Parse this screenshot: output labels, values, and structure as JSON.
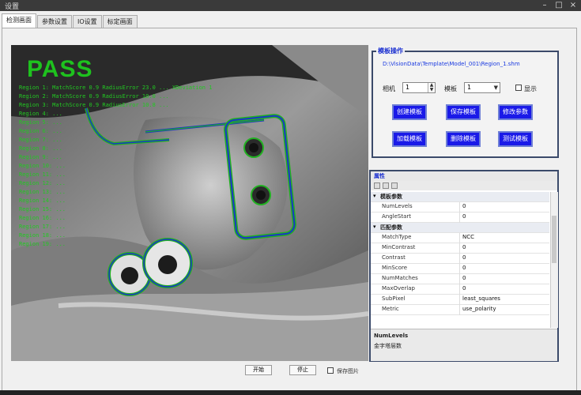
{
  "window": {
    "title": "设置"
  },
  "tabs": [
    {
      "label": "检测画面",
      "active": true
    },
    {
      "label": "参数设置",
      "active": false
    },
    {
      "label": "IO设置",
      "active": false
    },
    {
      "label": "标定画面",
      "active": false
    }
  ],
  "viewer": {
    "result": "PASS",
    "result_color": "#1ec21e",
    "readouts": [
      "Region 1:  MatchScore 0.9   RadiusError 23.0   ...   XDeviation  1",
      "Region 2:  MatchScore 0.9   RadiusError 10.0   ...",
      "Region 3:  MatchScore 0.9   RadiusError 10.8   ...",
      "Region 4:  ...",
      "Region 5:  ...",
      "Region 6:  ...",
      "Region 7:  ...",
      "Region 8:  ...",
      "Region 9:  ...",
      "Region 10: ...",
      "Region 11: ...",
      "Region 12: ...",
      "Region 13: ...",
      "Region 14: ...",
      "Region 15: ...",
      "Region 16: ...",
      "Region 17: ...",
      "Region 18: ...",
      "Region 19: ..."
    ]
  },
  "operations": {
    "title": "模板操作",
    "path": "D:\\VisionData\\Template\\Model_001\\Region_1.shm",
    "camera_label": "相机",
    "camera_value": "1",
    "template_label": "模板",
    "template_value": "1",
    "checkbox_label": "显示",
    "buttons": [
      "创建模板",
      "保存模板",
      "修改参数",
      "加载模板",
      "删除模板",
      "测试模板"
    ]
  },
  "properties": {
    "title": "属性",
    "rows": [
      {
        "category": true,
        "key": "模板参数"
      },
      {
        "key": "NumLevels",
        "value": "0"
      },
      {
        "key": "AngleStart",
        "value": "0"
      },
      {
        "category": true,
        "key": "匹配参数"
      },
      {
        "key": "MatchType",
        "value": "NCC"
      },
      {
        "key": "MinContrast",
        "value": "0"
      },
      {
        "key": "Contrast",
        "value": "0"
      },
      {
        "key": "MinScore",
        "value": "0"
      },
      {
        "key": "NumMatches",
        "value": "0"
      },
      {
        "key": "MaxOverlap",
        "value": "0"
      },
      {
        "key": "SubPixel",
        "value": "least_squares"
      },
      {
        "key": "Metric",
        "value": "use_polarity"
      }
    ],
    "desc_title": "NumLevels",
    "desc_text": "金字塔层数"
  },
  "bottom": {
    "btn1": "开始",
    "btn2": "停止",
    "check_label": "保存图片"
  }
}
